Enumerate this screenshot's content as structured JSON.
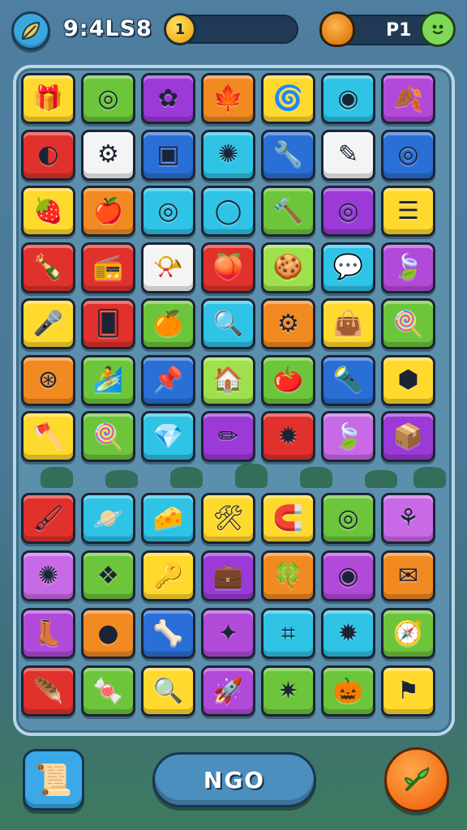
{
  "header": {
    "clock": "9:4LS8",
    "coin_glyph": "1",
    "player_label": "P1",
    "menu_icon": "leaf-icon",
    "shell_icon": "shell-icon",
    "face_icon": "smiley-face-icon"
  },
  "board": {
    "top_rows": [
      [
        {
          "icon": "gift-box-icon",
          "glyph": "🎁",
          "color": "#ffd92e"
        },
        {
          "icon": "ring-icon",
          "glyph": "◎",
          "color": "#6cc53b"
        },
        {
          "icon": "flower-icon",
          "glyph": "✿",
          "color": "#9b3ad6"
        },
        {
          "icon": "maple-leaf-icon",
          "glyph": "🍁",
          "color": "#f28a22"
        },
        {
          "icon": "swirl-candy-icon",
          "glyph": "🌀",
          "color": "#ffd92e"
        },
        {
          "icon": "red-orb-icon",
          "glyph": "◉",
          "color": "#2fc3e6"
        },
        {
          "icon": "leaf-icon",
          "glyph": "🍂",
          "color": "#b24ad9"
        }
      ],
      [
        {
          "icon": "green-swirl-icon",
          "glyph": "◐",
          "color": "#e0312c"
        },
        {
          "icon": "gear-wheel-icon",
          "glyph": "⚙",
          "color": "#f4f4f4"
        },
        {
          "icon": "picture-frame-icon",
          "glyph": "▣",
          "color": "#2a6fd6"
        },
        {
          "icon": "egg-icon",
          "glyph": "✺",
          "color": "#2fc3e6"
        },
        {
          "icon": "wrench-icon",
          "glyph": "🔧",
          "color": "#2a6fd6"
        },
        {
          "icon": "crayon-icon",
          "glyph": "✎",
          "color": "#f4f4f4"
        },
        {
          "icon": "target-icon",
          "glyph": "◎",
          "color": "#2a6fd6"
        }
      ],
      [
        {
          "icon": "berry-icon",
          "glyph": "🍓",
          "color": "#ffd92e"
        },
        {
          "icon": "apple-icon",
          "glyph": "🍎",
          "color": "#f28a22"
        },
        {
          "icon": "spiral-icon",
          "glyph": "◎",
          "color": "#2fc3e6"
        },
        {
          "icon": "ring-icon",
          "glyph": "◯",
          "color": "#2fc3e6"
        },
        {
          "icon": "hammer-icon",
          "glyph": "🔨",
          "color": "#6cc53b"
        },
        {
          "icon": "donut-icon",
          "glyph": "◎",
          "color": "#9b3ad6"
        },
        {
          "icon": "note-icon",
          "glyph": "☰",
          "color": "#ffd92e"
        }
      ],
      [
        {
          "icon": "bottle-icon",
          "glyph": "🍾",
          "color": "#e0312c"
        },
        {
          "icon": "radio-icon",
          "glyph": "📻",
          "color": "#e0312c"
        },
        {
          "icon": "horn-icon",
          "glyph": "📯",
          "color": "#f4f4f4"
        },
        {
          "icon": "fruit-icon",
          "glyph": "🍑",
          "color": "#e0312c"
        },
        {
          "icon": "cookie-icon",
          "glyph": "🍪",
          "color": "#9fe04d"
        },
        {
          "icon": "chat-heart-icon",
          "glyph": "💬",
          "color": "#2fc3e6"
        },
        {
          "icon": "feather-leaf-icon",
          "glyph": "🍃",
          "color": "#b24ad9"
        }
      ],
      [
        {
          "icon": "microphone-icon",
          "glyph": "🎤",
          "color": "#ffd92e"
        },
        {
          "icon": "card-icon",
          "glyph": "🂠",
          "color": "#e0312c"
        },
        {
          "icon": "orange-fruit-icon",
          "glyph": "🍊",
          "color": "#6cc53b"
        },
        {
          "icon": "magnifier-icon",
          "glyph": "🔍",
          "color": "#2fc3e6"
        },
        {
          "icon": "cog-icon",
          "glyph": "⚙",
          "color": "#f28a22"
        },
        {
          "icon": "bag-icon",
          "glyph": "👜",
          "color": "#ffd92e"
        },
        {
          "icon": "fan-icon",
          "glyph": "🍭",
          "color": "#6cc53b"
        }
      ],
      [
        {
          "icon": "film-reel-icon",
          "glyph": "⊛",
          "color": "#f28a22"
        },
        {
          "icon": "surfboard-icon",
          "glyph": "🏄",
          "color": "#6cc53b"
        },
        {
          "icon": "pin-icon",
          "glyph": "📌",
          "color": "#2a6fd6"
        },
        {
          "icon": "house-icon",
          "glyph": "🏠",
          "color": "#9fe04d"
        },
        {
          "icon": "tomato-icon",
          "glyph": "🍅",
          "color": "#6cc53b"
        },
        {
          "icon": "torch-icon",
          "glyph": "🔦",
          "color": "#2a6fd6"
        },
        {
          "icon": "cube-icon",
          "glyph": "⬢",
          "color": "#ffd92e"
        }
      ],
      [
        {
          "icon": "axe-icon",
          "glyph": "🪓",
          "color": "#ffd92e"
        },
        {
          "icon": "lollipop-icon",
          "glyph": "🍭",
          "color": "#6cc53b"
        },
        {
          "icon": "gem-icon",
          "glyph": "💎",
          "color": "#2fc3e6"
        },
        {
          "icon": "pencil-icon",
          "glyph": "✏",
          "color": "#9b3ad6"
        },
        {
          "icon": "sun-gear-icon",
          "glyph": "✹",
          "color": "#e0312c"
        },
        {
          "icon": "green-leaf-icon",
          "glyph": "🍃",
          "color": "#c86ae6"
        },
        {
          "icon": "box-icon",
          "glyph": "📦",
          "color": "#9b3ad6"
        }
      ]
    ],
    "bottom_rows": [
      [
        {
          "icon": "paint-tube-icon",
          "glyph": "🖌",
          "color": "#e0312c"
        },
        {
          "icon": "planet-icon",
          "glyph": "🪐",
          "color": "#2fc3e6"
        },
        {
          "icon": "cheese-icon",
          "glyph": "🧀",
          "color": "#2fc3e6"
        },
        {
          "icon": "tools-icon",
          "glyph": "🛠",
          "color": "#ffd92e"
        },
        {
          "icon": "magnet-icon",
          "glyph": "🧲",
          "color": "#ffd92e"
        },
        {
          "icon": "green-ring-icon",
          "glyph": "◎",
          "color": "#6cc53b"
        },
        {
          "icon": "pin-flower-icon",
          "glyph": "⚘",
          "color": "#c86ae6"
        }
      ],
      [
        {
          "icon": "sun-flower-icon",
          "glyph": "✺",
          "color": "#c86ae6"
        },
        {
          "icon": "crystal-icon",
          "glyph": "❖",
          "color": "#6cc53b"
        },
        {
          "icon": "key-icon",
          "glyph": "🔑",
          "color": "#ffd92e"
        },
        {
          "icon": "briefcase-icon",
          "glyph": "💼",
          "color": "#9b3ad6"
        },
        {
          "icon": "leaf-badge-icon",
          "glyph": "🍀",
          "color": "#f28a22"
        },
        {
          "icon": "vortex-icon",
          "glyph": "◉",
          "color": "#b24ad9"
        },
        {
          "icon": "stamp-icon",
          "glyph": "✉",
          "color": "#f28a22"
        }
      ],
      [
        {
          "icon": "boot-icon",
          "glyph": "👢",
          "color": "#b24ad9"
        },
        {
          "icon": "ball-icon",
          "glyph": "●",
          "color": "#f28a22"
        },
        {
          "icon": "bone-icon",
          "glyph": "🦴",
          "color": "#2a6fd6"
        },
        {
          "icon": "spinning-top-icon",
          "glyph": "✦",
          "color": "#b24ad9"
        },
        {
          "icon": "keypad-icon",
          "glyph": "⌗",
          "color": "#2fc3e6"
        },
        {
          "icon": "gear-flower-icon",
          "glyph": "✹",
          "color": "#2fc3e6"
        },
        {
          "icon": "compass-icon",
          "glyph": "🧭",
          "color": "#6cc53b"
        }
      ],
      [
        {
          "icon": "feather-icon",
          "glyph": "🪶",
          "color": "#e0312c"
        },
        {
          "icon": "candy-icon",
          "glyph": "🍬",
          "color": "#6cc53b"
        },
        {
          "icon": "search-icon",
          "glyph": "🔍",
          "color": "#ffd92e"
        },
        {
          "icon": "rocket-icon",
          "glyph": "🚀",
          "color": "#b24ad9"
        },
        {
          "icon": "virus-icon",
          "glyph": "✷",
          "color": "#6cc53b"
        },
        {
          "icon": "pumpkin-icon",
          "glyph": "🎃",
          "color": "#6cc53b"
        },
        {
          "icon": "flag-icon",
          "glyph": "⚑",
          "color": "#ffd92e"
        }
      ]
    ]
  },
  "footer": {
    "map_icon": "map-scroll-icon",
    "center_button_label": "NGO",
    "right_icon": "leaf-wand-icon"
  }
}
